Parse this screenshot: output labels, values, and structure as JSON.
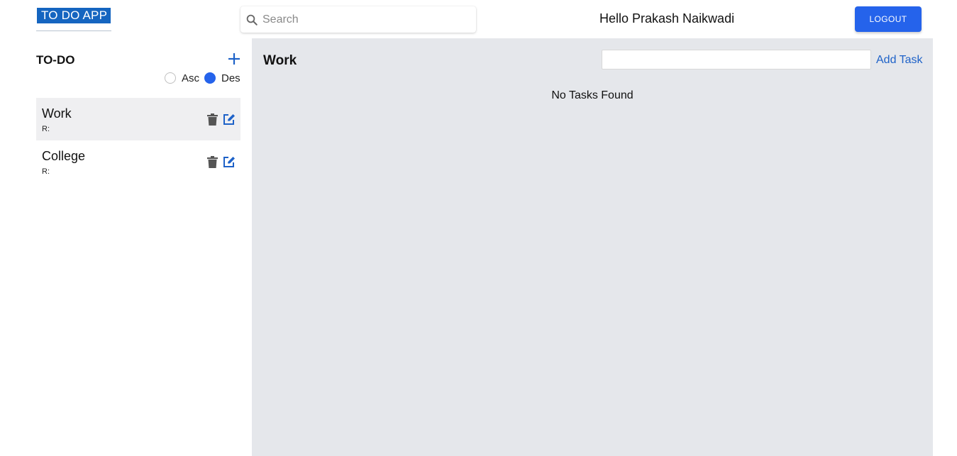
{
  "header": {
    "logo_text": "TO DO APP",
    "search_placeholder": "Search",
    "search_value": "",
    "greeting": "Hello Prakash Naikwadi",
    "logout_label": "LOGOUT"
  },
  "sidebar": {
    "title": "TO-DO",
    "add_icon": "plus-icon",
    "sort": {
      "options": [
        "Asc",
        "Des"
      ],
      "selected": "Des"
    },
    "items": [
      {
        "title": "Work",
        "subtitle": "R:",
        "active": true
      },
      {
        "title": "College",
        "subtitle": "R:",
        "active": false
      }
    ]
  },
  "main": {
    "title": "Work",
    "task_input_value": "",
    "add_task_label": "Add Task",
    "empty_message": "No Tasks Found"
  },
  "colors": {
    "primary": "#2563eb",
    "logo_bg": "#1565c0",
    "link": "#1e62c8",
    "panel_bg": "#e5e7eb",
    "active_item_bg": "#efeff1"
  }
}
